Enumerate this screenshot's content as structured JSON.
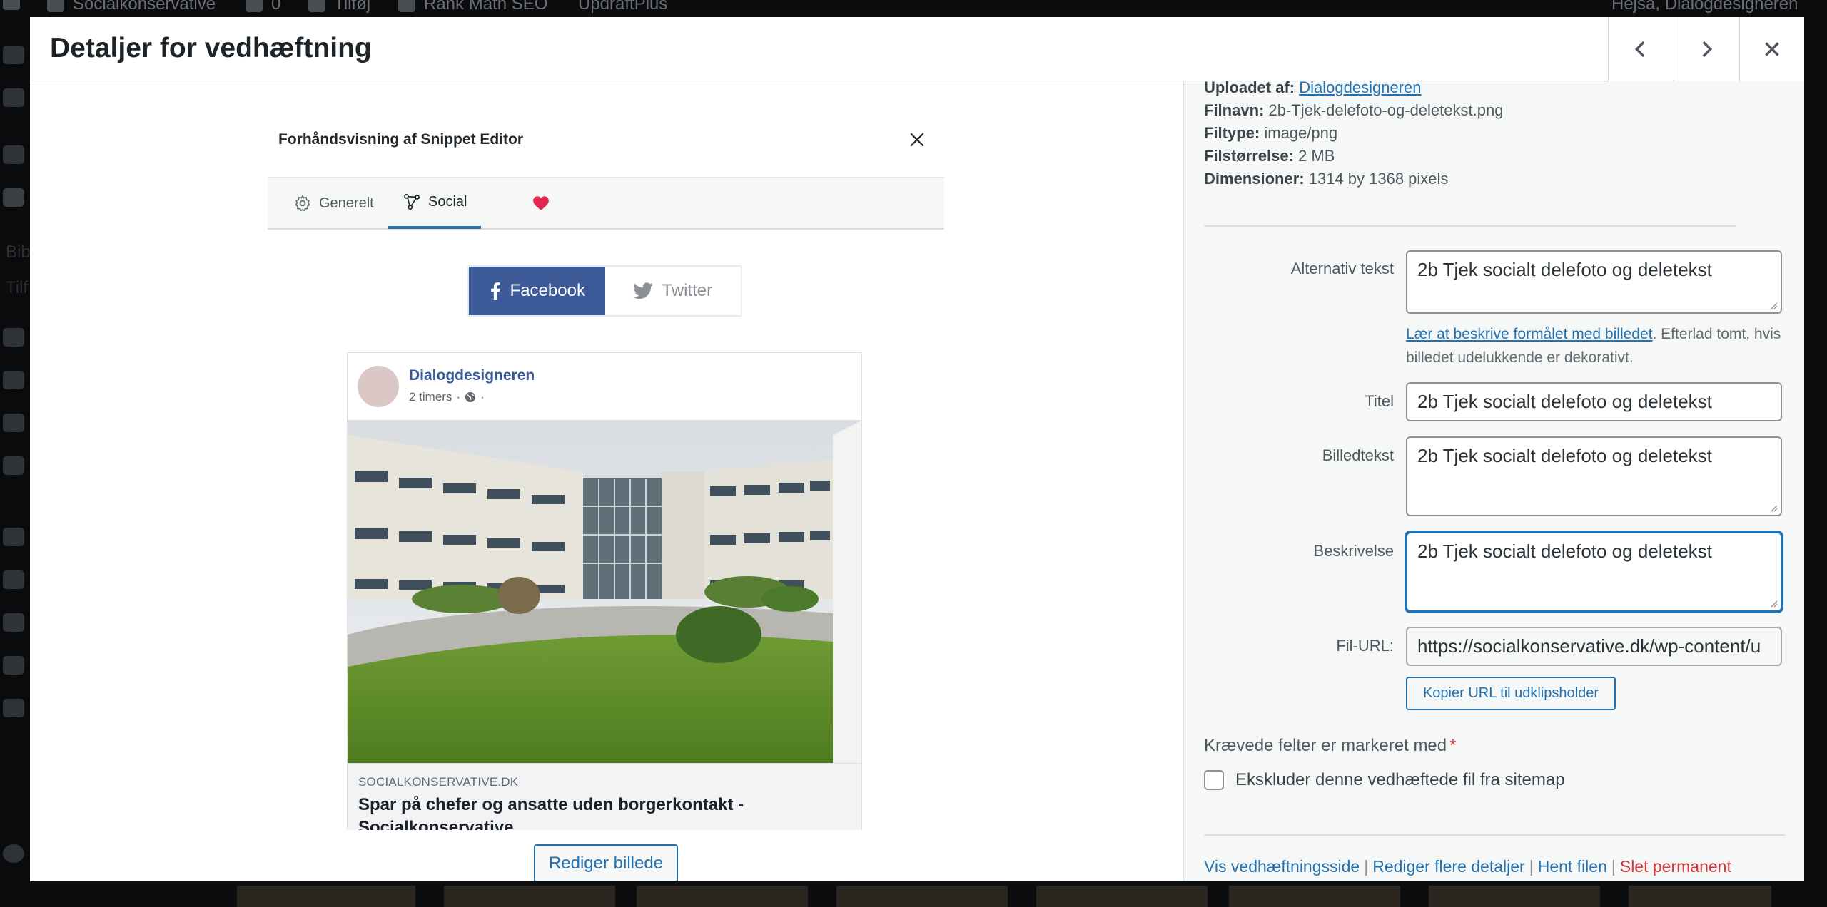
{
  "backdrop": {
    "adminbar_items": [
      "Socialkonservative",
      "0",
      "Tilføj",
      "Rank Math SEO",
      "UpdraftPlus"
    ],
    "greeting": "Hejsa, Dialogdesigneren",
    "sidebar_text": [
      "Bib",
      "Tilf"
    ]
  },
  "modal": {
    "title": "Detaljer for vedhæftning",
    "prev_label": "Forrige",
    "next_label": "Næste",
    "close_label": "Luk"
  },
  "preview": {
    "title": "Forhåndsvisning af Snippet Editor",
    "tabs": [
      "Generelt",
      "Social"
    ],
    "social_buttons": [
      "Facebook",
      "Twitter"
    ],
    "card": {
      "author": "Dialogdesigneren",
      "time": "2 timers",
      "domain": "SOCIALKONSERVATIVE.DK",
      "headline": "Spar på chefer og ansatte uden borgerkontakt - Socialkonservative"
    },
    "edit_image": "Rediger billede"
  },
  "details": {
    "uploaded_by_label": "Uploadet af:",
    "uploaded_by": "Dialogdesigneren",
    "filename_label": "Filnavn:",
    "filename": "2b-Tjek-delefoto-og-deletekst.png",
    "filetype_label": "Filtype:",
    "filetype": "image/png",
    "filesize_label": "Filstørrelse:",
    "filesize": "2 MB",
    "dimensions_label": "Dimensioner:",
    "dimensions": "1314 by 1368 pixels",
    "alt_label": "Alternativ tekst",
    "alt_value": "2b Tjek socialt delefoto og deletekst",
    "alt_help_link": "Lær at beskrive formålet med billedet",
    "alt_help_rest": ". Efterlad tomt, hvis billedet udelukkende er dekorativt.",
    "title_label": "Titel",
    "title_value": "2b Tjek socialt delefoto og deletekst",
    "caption_label": "Billedtekst",
    "caption_value": "2b Tjek socialt delefoto og deletekst",
    "description_label": "Beskrivelse",
    "description_value": "2b Tjek socialt delefoto og deletekst",
    "url_label": "Fil-URL:",
    "url_value": "https://socialkonservative.dk/wp-content/u",
    "copy_url": "Kopier URL til udklipsholder",
    "required_note": "Krævede felter er markeret med",
    "required_star": "*",
    "sitemap_label": "Ekskluder denne vedhæftede fil fra sitemap",
    "actions": {
      "view": "Vis vedhæftningsside",
      "edit_more": "Rediger flere detaljer",
      "download": "Hent filen",
      "delete": "Slet permanent",
      "separator": "|"
    }
  },
  "colors": {
    "accent": "#2271b1",
    "facebook": "#3d5a98",
    "danger": "#d63638",
    "heart": "#e2264d"
  }
}
